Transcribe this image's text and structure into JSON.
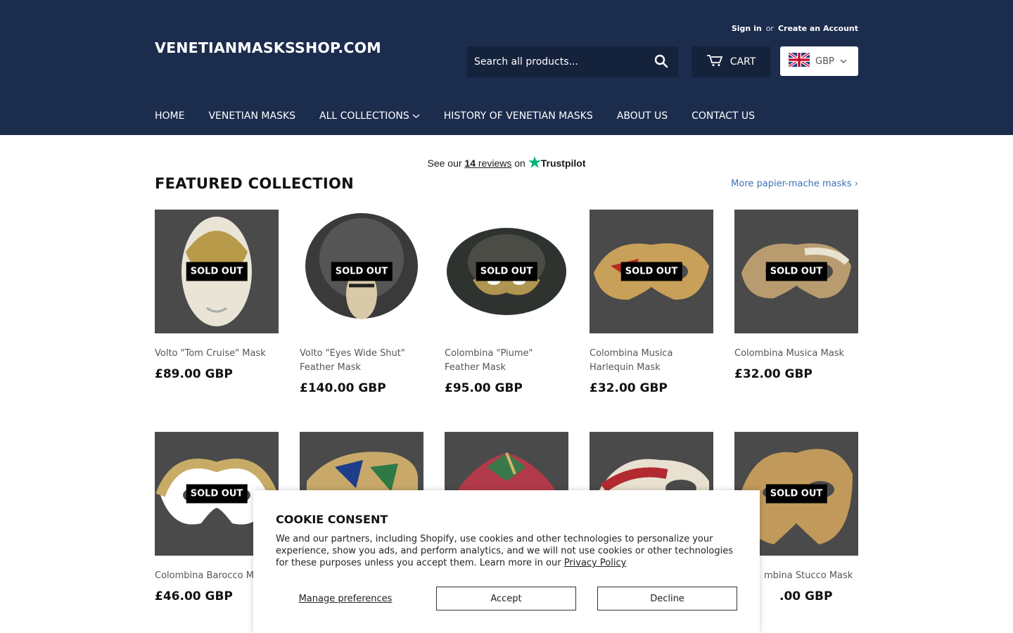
{
  "header": {
    "logo": "VENETIANMASKSSHOP.COM",
    "sign_in": "Sign in",
    "or": "or",
    "create_account": "Create an Account",
    "search_placeholder": "Search all products...",
    "cart_label": "CART",
    "currency": "GBP"
  },
  "nav": {
    "items": [
      "HOME",
      "VENETIAN MASKS",
      "ALL COLLECTIONS",
      "HISTORY OF VENETIAN MASKS",
      "ABOUT US",
      "CONTACT US"
    ]
  },
  "trustpilot": {
    "prefix": "See our",
    "count": "14",
    "reviews": "reviews",
    "on": "on",
    "brand": "Trustpilot"
  },
  "featured": {
    "title": "FEATURED COLLECTION",
    "more_link": "More papier-mache masks ›",
    "sold_out_label": "SOLD OUT",
    "row1": [
      {
        "name": "Volto \"Tom Cruise\" Mask",
        "price": "£89.00 GBP"
      },
      {
        "name": "Volto \"Eyes Wide Shut\" Feather Mask",
        "price": "£140.00 GBP"
      },
      {
        "name": "Colombina \"Piume\" Feather Mask",
        "price": "£95.00 GBP"
      },
      {
        "name": "Colombina Musica Harlequin Mask",
        "price": "£32.00 GBP"
      },
      {
        "name": "Colombina Musica Mask",
        "price": "£32.00 GBP"
      }
    ],
    "row2": [
      {
        "name": "Colombina Barocco M",
        "price": "£46.00 GBP"
      },
      {
        "name": "",
        "price": ""
      },
      {
        "name": "",
        "price": ""
      },
      {
        "name": "",
        "price": ""
      },
      {
        "name": "mbina Stucco Mask",
        "price": ".00 GBP"
      }
    ]
  },
  "cookie": {
    "title": "COOKIE CONSENT",
    "text": "We and our partners, including Shopify, use cookies and other technologies to personalize your experience, show you ads, and perform analytics, and we will not use cookies or other technologies for these purposes unless you accept them. Learn more in our",
    "privacy": "Privacy Policy",
    "manage": "Manage preferences",
    "accept": "Accept",
    "decline": "Decline"
  },
  "colors": {
    "header_bg": "#1c2c4d",
    "link": "#3a73b4",
    "trustpilot_star": "#00b67a"
  }
}
